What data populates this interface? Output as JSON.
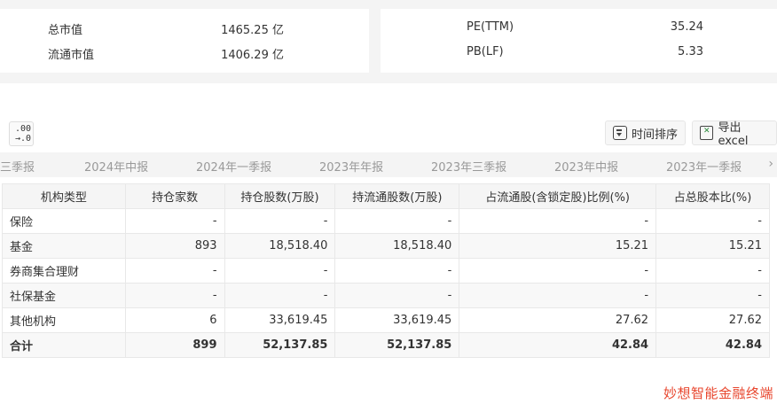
{
  "summary": {
    "left": [
      {
        "label": "总市值",
        "value": "1465.25 亿"
      },
      {
        "label": "流通市值",
        "value": "1406.29 亿"
      }
    ],
    "right": [
      {
        "label": "PE(TTM)",
        "value": "35.24"
      },
      {
        "label": "PB(LF)",
        "value": "5.33"
      }
    ]
  },
  "toolbar": {
    "decimal_top": ".00",
    "decimal_bottom": "→.0",
    "sort_label": "时间排序",
    "export_label": "导出excel"
  },
  "period_tabs": [
    "三季报",
    "2024年中报",
    "2024年一季报",
    "2023年年报",
    "2023年三季报",
    "2023年中报",
    "2023年一季报"
  ],
  "tab_arrow": "›",
  "table": {
    "headers": [
      "机构类型",
      "持仓家数",
      "持仓股数(万股)",
      "持流通股数(万股)",
      "占流通股(含锁定股)比例(%)",
      "占总股本比(%)"
    ],
    "rows": [
      [
        "保险",
        "-",
        "-",
        "-",
        "-",
        "-"
      ],
      [
        "基金",
        "893",
        "18,518.40",
        "18,518.40",
        "15.21",
        "15.21"
      ],
      [
        "券商集合理财",
        "-",
        "-",
        "-",
        "-",
        "-"
      ],
      [
        "社保基金",
        "-",
        "-",
        "-",
        "-",
        "-"
      ],
      [
        "其他机构",
        "6",
        "33,619.45",
        "33,619.45",
        "27.62",
        "27.62"
      ]
    ],
    "total": [
      "合计",
      "899",
      "52,137.85",
      "52,137.85",
      "42.84",
      "42.84"
    ]
  },
  "watermark": "妙想智能金融终端"
}
